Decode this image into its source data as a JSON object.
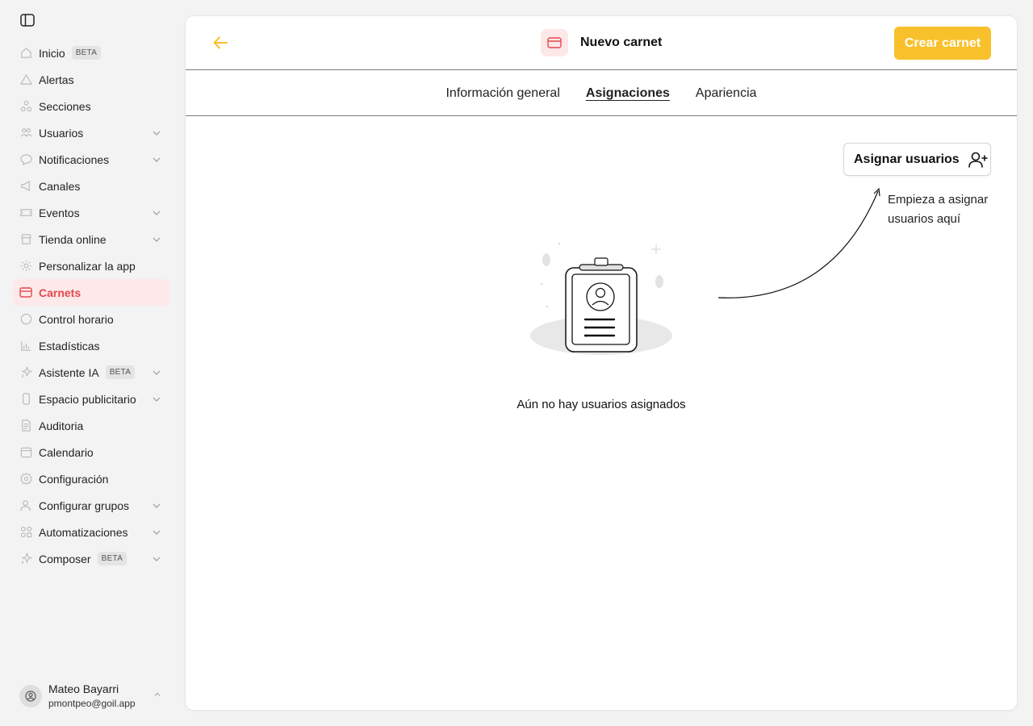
{
  "sidebar": {
    "items": [
      {
        "label": "Inicio",
        "icon": "home-icon",
        "badge": "BETA",
        "chevron": false
      },
      {
        "label": "Alertas",
        "icon": "alert-triangle-icon",
        "chevron": false
      },
      {
        "label": "Secciones",
        "icon": "sections-icon",
        "chevron": false
      },
      {
        "label": "Usuarios",
        "icon": "users-icon",
        "chevron": true
      },
      {
        "label": "Notificaciones",
        "icon": "chat-bubble-icon",
        "chevron": true
      },
      {
        "label": "Canales",
        "icon": "megaphone-icon",
        "chevron": false
      },
      {
        "label": "Eventos",
        "icon": "ticket-icon",
        "chevron": true
      },
      {
        "label": "Tienda online",
        "icon": "store-icon",
        "chevron": true
      },
      {
        "label": "Personalizar la app",
        "icon": "customize-icon",
        "chevron": false
      },
      {
        "label": "Carnets",
        "icon": "card-icon",
        "chevron": false,
        "active": true
      },
      {
        "label": "Control horario",
        "icon": "clock-icon",
        "chevron": false
      },
      {
        "label": "Estadísticas",
        "icon": "bar-chart-icon",
        "chevron": false
      },
      {
        "label": "Asistente IA",
        "icon": "sparkle-icon",
        "badge": "BETA",
        "chevron": true
      },
      {
        "label": "Espacio publicitario",
        "icon": "phone-icon",
        "chevron": true
      },
      {
        "label": "Auditoria",
        "icon": "document-icon",
        "chevron": false
      },
      {
        "label": "Calendario",
        "icon": "calendar-icon",
        "chevron": false
      },
      {
        "label": "Configuración",
        "icon": "gear-icon",
        "chevron": false
      },
      {
        "label": "Configurar grupos",
        "icon": "user-group-icon",
        "chevron": true
      },
      {
        "label": "Automatizaciones",
        "icon": "automation-icon",
        "chevron": true
      },
      {
        "label": "Composer",
        "icon": "sparkle-icon",
        "badge": "BETA",
        "chevron": true
      }
    ]
  },
  "user": {
    "name": "Mateo Bayarri",
    "email": "pmontpeo@goil.app"
  },
  "header": {
    "title": "Nuevo carnet",
    "create_label": "Crear carnet"
  },
  "tabs": [
    {
      "label": "Información general",
      "active": false
    },
    {
      "label": "Asignaciones",
      "active": true
    },
    {
      "label": "Apariencia",
      "active": false
    }
  ],
  "assign": {
    "button_label": "Asignar usuarios",
    "hint": "Empieza a asignar usuarios aquí"
  },
  "empty_state": {
    "message": "Aún no hay usuarios asignados"
  },
  "colors": {
    "accent": "#f8c12b",
    "active": "#e5484d",
    "active_bg": "#fde9e9"
  }
}
